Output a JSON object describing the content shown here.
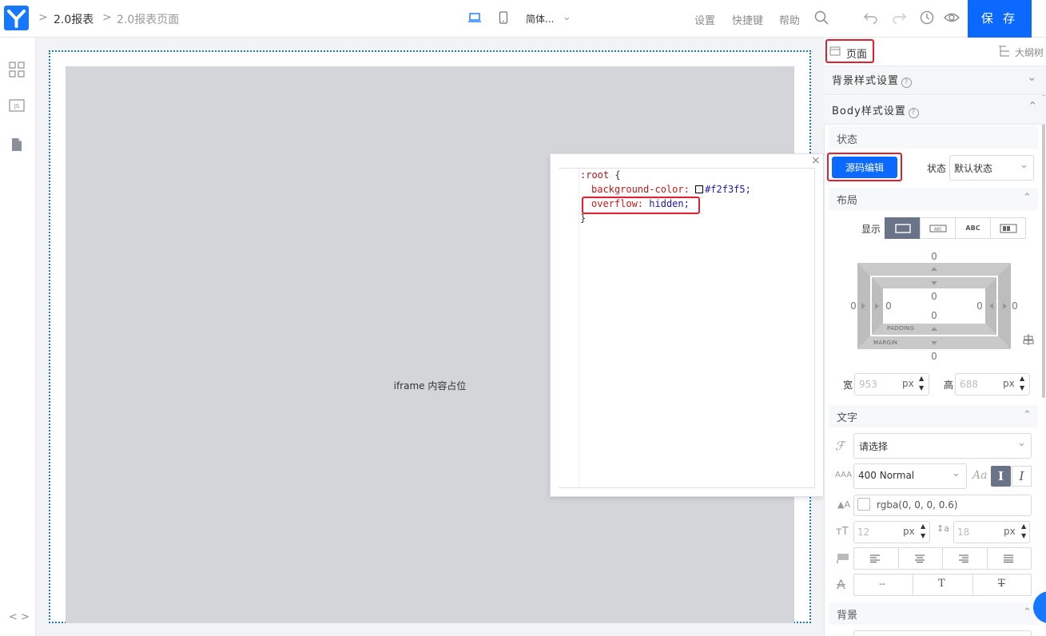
{
  "topbar": {
    "breadcrumb": [
      "2.0报表",
      "2.0报表页面"
    ],
    "language": "简体...",
    "menu": [
      "设置",
      "快捷键",
      "帮助"
    ],
    "save_label": "保 存"
  },
  "canvas": {
    "placeholder": "iframe 内容占位"
  },
  "code_editor": {
    "lines": [
      {
        "selector": ":root",
        "brace": " {"
      },
      {
        "prop": "background-color:",
        "val": "#f2f3f5;"
      },
      {
        "prop": "overflow:",
        "val": "hidden;"
      },
      {
        "brace": "}"
      }
    ],
    "close_icon": "close-icon"
  },
  "right_panel": {
    "tab_page": "页面",
    "tab_outline": "大纲树",
    "bg_section": "背景样式设置",
    "body_section": "Body样式设置",
    "state_section": "状态",
    "source_edit_button": "源码编辑",
    "state_label": "状态",
    "state_value": "默认状态",
    "layout_section": "布局",
    "display_label": "显示",
    "display_options": [
      "block",
      "ABC",
      "ABC",
      "flex"
    ],
    "margin_top": "0",
    "margin_bottom": "0",
    "margin_left": "0",
    "margin_right": "0",
    "padding_top": "0",
    "padding_bottom": "0",
    "padding_left": "0",
    "padding_right": "0",
    "padding_caption": "PADDING",
    "margin_caption": "MARGIN",
    "width_label": "宽",
    "width_placeholder": "953",
    "height_label": "高",
    "height_placeholder": "688",
    "unit_px": "px",
    "text_section": "文字",
    "font_family_placeholder": "请选择",
    "font_weight": "400 Normal",
    "font_style_normal": "I",
    "font_style_italic": "I",
    "font_color": "rgba(0, 0, 0, 0.6)",
    "font_size_placeholder": "12",
    "line_height_placeholder": "18",
    "decoration_none": "--",
    "decoration_underline": "T",
    "decoration_strike": "T",
    "background_section": "背景"
  },
  "colors": {
    "accent": "#0b69ff",
    "highlight": "#e0202e",
    "canvas_bg": "#d4d5d8",
    "root_bg": "#f2f3f5"
  }
}
